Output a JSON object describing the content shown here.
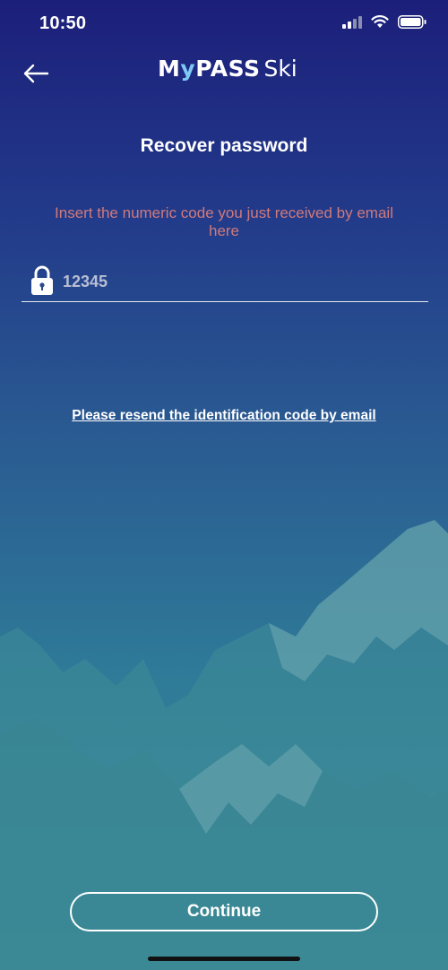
{
  "status_bar": {
    "time": "10:50",
    "icons": [
      "cellular-signal-icon",
      "wifi-icon",
      "battery-icon"
    ]
  },
  "header": {
    "back_icon": "arrow-left-icon",
    "logo": {
      "part1": "M",
      "part2": "y",
      "part3": "PASS",
      "part4": "Ski"
    }
  },
  "title": "Recover password",
  "instruction": "Insert the numeric code you just received by email here",
  "code_field": {
    "placeholder": "12345",
    "value": "",
    "icon": "lock-icon"
  },
  "resend_link": "Please resend the identification code by email",
  "continue_button": "Continue",
  "colors": {
    "accent_instruction": "#d07a7a",
    "logo_y": "#7ec8f6",
    "background_top": "#1c1f7a",
    "background_bottom": "#3a8e9a"
  }
}
